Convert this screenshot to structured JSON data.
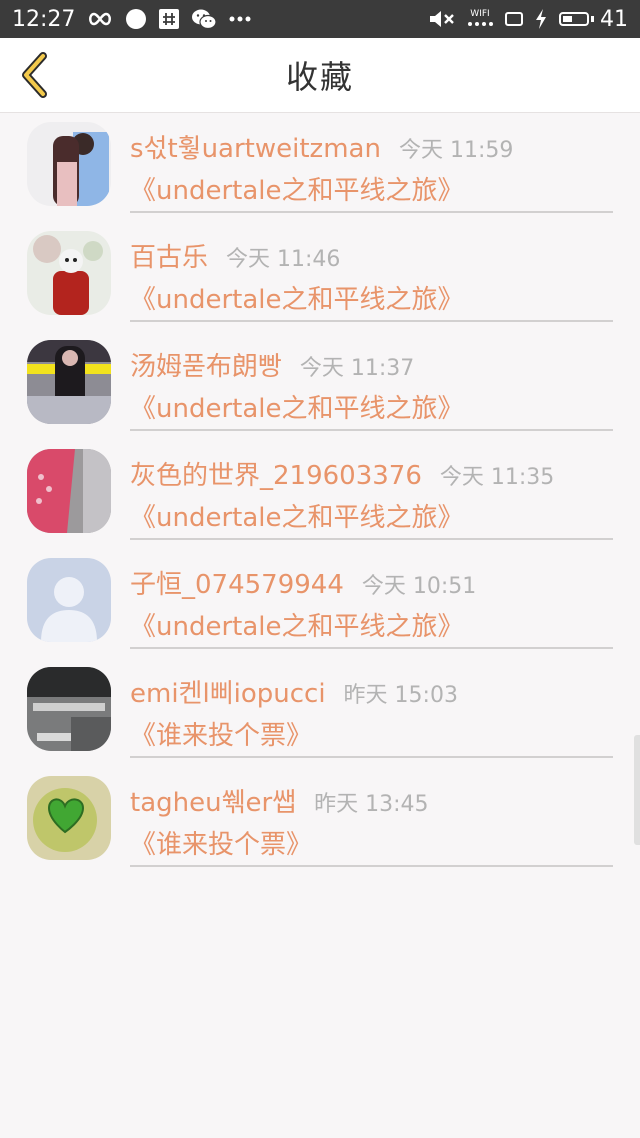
{
  "status_bar": {
    "time": "12:27",
    "wifi_label": "WIFI",
    "battery": "41",
    "battery_level": 0.41,
    "icons": [
      "infinity-icon",
      "chat-bubble-icon",
      "hash-icon",
      "wechat-icon",
      "more-dots-icon",
      "mute-icon",
      "wifi-icon",
      "screen-icon",
      "charging-icon",
      "battery-icon"
    ]
  },
  "header": {
    "title": "收藏",
    "back_icon": "back-chevron-icon",
    "accent_color": "#f2c94c"
  },
  "colors": {
    "name": "#e8946a",
    "time": "#b3b3b3",
    "divider": "#d2d0d0"
  },
  "items": [
    {
      "name": "s섟t훻uartweitzman",
      "time": "今天 11:59",
      "work": "《undertale之和平线之旅》",
      "avatar": "avatar-photo-couple"
    },
    {
      "name": "百古乐",
      "time": "今天 11:46",
      "work": "《undertale之和平线之旅》",
      "avatar": "avatar-photo-red-cloak"
    },
    {
      "name": "汤姆푿布朗빵",
      "time": "今天 11:37",
      "work": "《undertale之和平线之旅》",
      "avatar": "avatar-photo-girl-banner"
    },
    {
      "name": "灰色的世界_219603376",
      "time": "今天 11:35",
      "work": "《undertale之和平线之旅》",
      "avatar": "avatar-photo-pink"
    },
    {
      "name": "子恒_074579944",
      "time": "今天 10:51",
      "work": "《undertale之和平线之旅》",
      "avatar": "avatar-default-person"
    },
    {
      "name": "emi켄l삐iopucci",
      "time": "昨天 15:03",
      "work": "《谁来投个票》",
      "avatar": "avatar-photo-text-grey"
    },
    {
      "name": "tagheu쒞er쌥",
      "time": "昨天 13:45",
      "work": "《谁来投个票》",
      "avatar": "avatar-green-heart"
    }
  ]
}
